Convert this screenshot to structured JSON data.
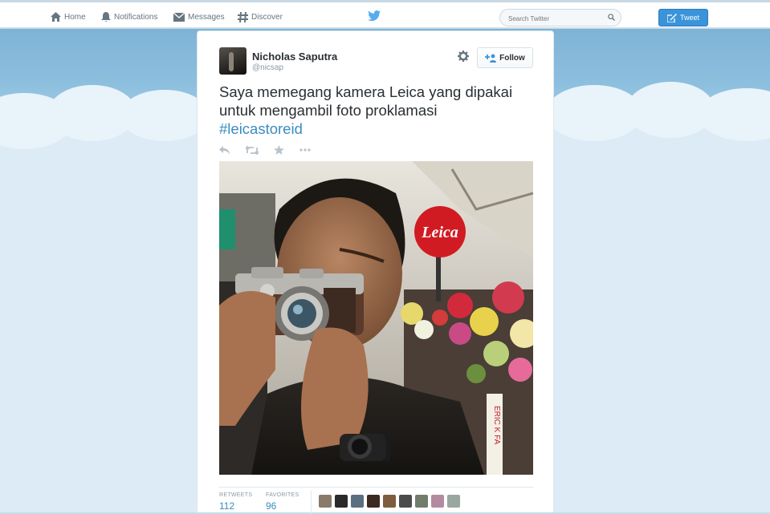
{
  "nav": {
    "home": "Home",
    "notifications": "Notifications",
    "messages": "Messages",
    "discover": "Discover"
  },
  "search": {
    "placeholder": "Search Twitter"
  },
  "compose": {
    "label": "Tweet"
  },
  "tweet": {
    "fullname": "Nicholas Saputra",
    "username": "@nicsap",
    "follow_label": "Follow",
    "text": "Saya memegang kamera Leica yang dipakai untuk mengambil foto proklamasi",
    "hashtag": "#leicastoreid",
    "image_text": {
      "sign": "Leica",
      "ribbon": "ERIC K FA"
    },
    "stats": {
      "retweets_label": "RETWEETS",
      "retweets": "112",
      "favorites_label": "FAVORITES",
      "favorites": "96"
    }
  },
  "colors": {
    "link": "#3a8cbf",
    "tweet_button": "#3b94d9",
    "twitter_bird": "#55acee",
    "leica_red": "#d11b23"
  },
  "icons": [
    "home-icon",
    "notifications-icon",
    "messages-icon",
    "discover-icon",
    "twitter-bird-icon",
    "search-icon",
    "compose-icon",
    "gear-icon",
    "follow-icon",
    "reply-icon",
    "retweet-icon",
    "favorite-icon",
    "more-icon"
  ]
}
